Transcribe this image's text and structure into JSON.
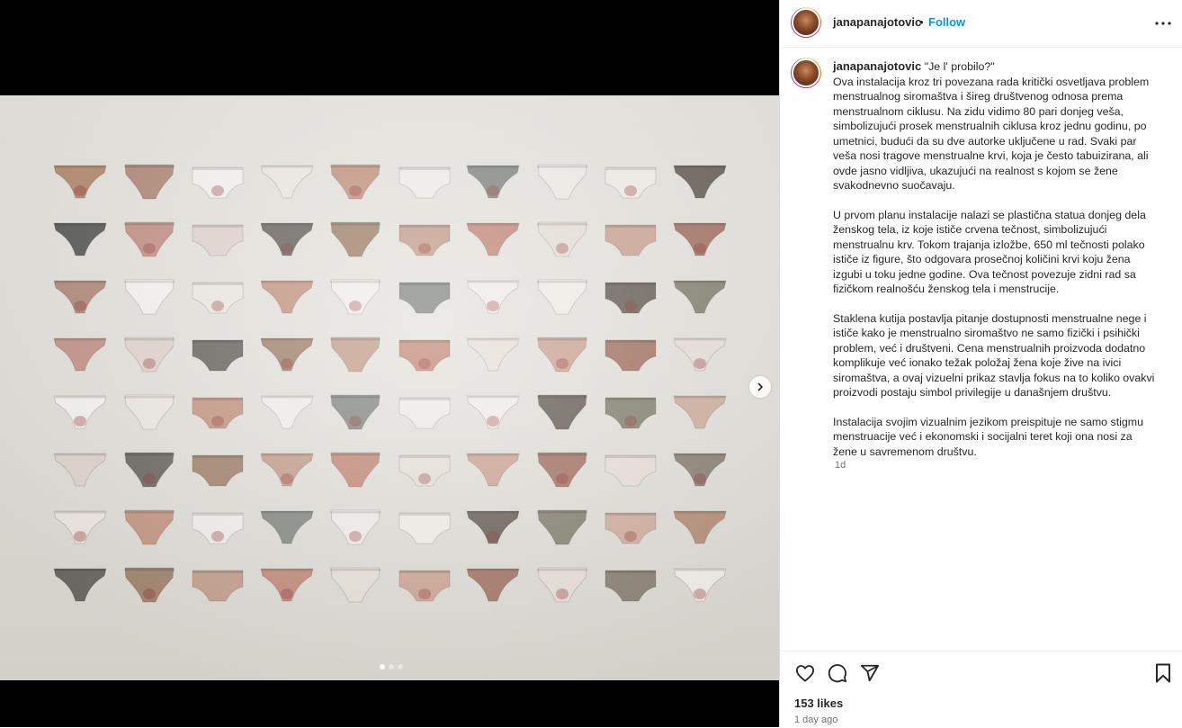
{
  "post": {
    "username": "janapanajotovic",
    "follow_label": "Follow",
    "separator": "•",
    "caption_title": "\"Je l' probilo?\"",
    "caption_paragraphs": [
      "Ova instalacija kroz tri povezana rada kritički osvetljava problem menstrualnog siromaštva i šireg društvenog odnosa prema menstrualnom ciklusu. Na zidu vidimo 80 pari donjeg veša, simbolizujući prosek menstrualnih ciklusa kroz jednu godinu, po umetnici, budući da su dve autorke uključene u rad. Svaki par veša nosi tragove menstrualne krvi, koja je često tabuizirana, ali ovde jasno vidljiva, ukazujući na realnost s kojom se žene svakodnevno suočavaju.",
      "U prvom planu instalacije nalazi se plastična statua donjeg dela ženskog tela, iz koje ističe crvena tečnost, simbolizujući menstrualnu krv. Tokom trajanja izložbe, 650 ml tečnosti polako ističe iz figure, što odgovara prosečnoj količini krvi koju žena izgubi u toku jedne godine. Ova tečnost povezuje zidni rad sa fizičkom realnošću ženskog tela i menstrucije.",
      "Staklena kutija postavlja pitanje dostupnosti menstrualne nege i ističe kako je menstrualno siromaštvo ne samo fizički i psihički problem, već i društveni. Cena menstrualnih proizvoda dodatno komplikuje već ionako težak položaj žena koje žive na ivici siromaštva, a ovaj vizuelni prikaz stavlja fokus na to koliko ovakvi proizvodi postaju simbol privilegije u današnjem društvu.",
      "Instalacija svojim vizualnim jezikom preispituje ne samo stigmu menstruacije već i ekonomski i socijalni teret koji ona nosi za žene u savremenom društvu."
    ],
    "caption_time": "1d",
    "likes": "153 likes",
    "posted_ago": "1 day ago"
  },
  "icons": {
    "like": "heart-icon",
    "comment": "comment-icon",
    "share": "share-icon",
    "save": "bookmark-icon",
    "more": "more-options-icon",
    "next": "chevron-right-icon"
  },
  "carousel": {
    "slide_count": 3,
    "active_index": 0
  },
  "colors": {
    "follow": "#0095f6",
    "text": "#262626",
    "muted": "#737373"
  }
}
